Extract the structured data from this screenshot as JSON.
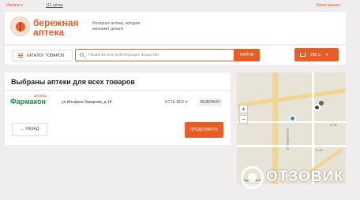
{
  "topbar": {
    "city": "Ижевск ▾",
    "pharmacy_count": "111 аптек",
    "orders": "Ваши заказы"
  },
  "header": {
    "logo_line1": "бережная",
    "logo_line2": "аптека",
    "tagline": "Интернет-аптека, которая экономит деньги"
  },
  "search": {
    "catalog_label": "КАТАЛОГ ТОВАРОВ",
    "placeholder": "Название или действующее вещество",
    "button_label": "НАЙТИ"
  },
  "cart": {
    "total": "205 р."
  },
  "selection": {
    "title": "Выбраны аптеки для всех товаров",
    "pharmacy_small": "АПТЕКА",
    "pharmacy_name": "Фармакон",
    "address": "ул.Ильфата Закирова, д.14",
    "availability": "ЕСТЬ ВСЕ ▾",
    "status": "ВЫБРАНО",
    "back_label": "← НАЗАД",
    "continue_label": "ПРОДОЛЖИТЬ"
  },
  "map": {
    "zoom_in": "+",
    "zoom_out": "−",
    "labels": [
      "ул. Воровского",
      "А-15",
      "А-10"
    ],
    "footer": "Яндекс.Карты"
  },
  "watermark": {
    "text": "ОТЗОВИК"
  },
  "colors": {
    "accent": "#e85d25",
    "pharmacy_green": "#1f8a45",
    "map_pin_blue": "#3f83d8"
  }
}
